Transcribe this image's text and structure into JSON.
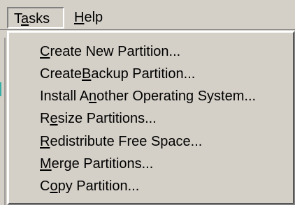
{
  "menubar": {
    "items": [
      {
        "label_before": "T",
        "mnemonic": "a",
        "label_after": "sks"
      },
      {
        "label_before": "",
        "mnemonic": "H",
        "label_after": "elp"
      }
    ]
  },
  "tasks_menu": {
    "items": [
      {
        "before": "",
        "mnemonic": "C",
        "after": "reate New Partition..."
      },
      {
        "before": "Create ",
        "mnemonic": "B",
        "after": "ackup Partition..."
      },
      {
        "before": "Install A",
        "mnemonic": "n",
        "after": "other Operating System..."
      },
      {
        "before": "R",
        "mnemonic": "e",
        "after": "size Partitions..."
      },
      {
        "before": "",
        "mnemonic": "R",
        "after": "edistribute Free Space..."
      },
      {
        "before": "",
        "mnemonic": "M",
        "after": "erge Partitions..."
      },
      {
        "before": "C",
        "mnemonic": "o",
        "after": "py Partition..."
      }
    ]
  },
  "colors": {
    "menu_background": "#d4d0c8",
    "text": "#000000",
    "highlight_edge": "#ffffff",
    "shadow_edge": "#808080",
    "accent_edge": "#00a39b"
  }
}
